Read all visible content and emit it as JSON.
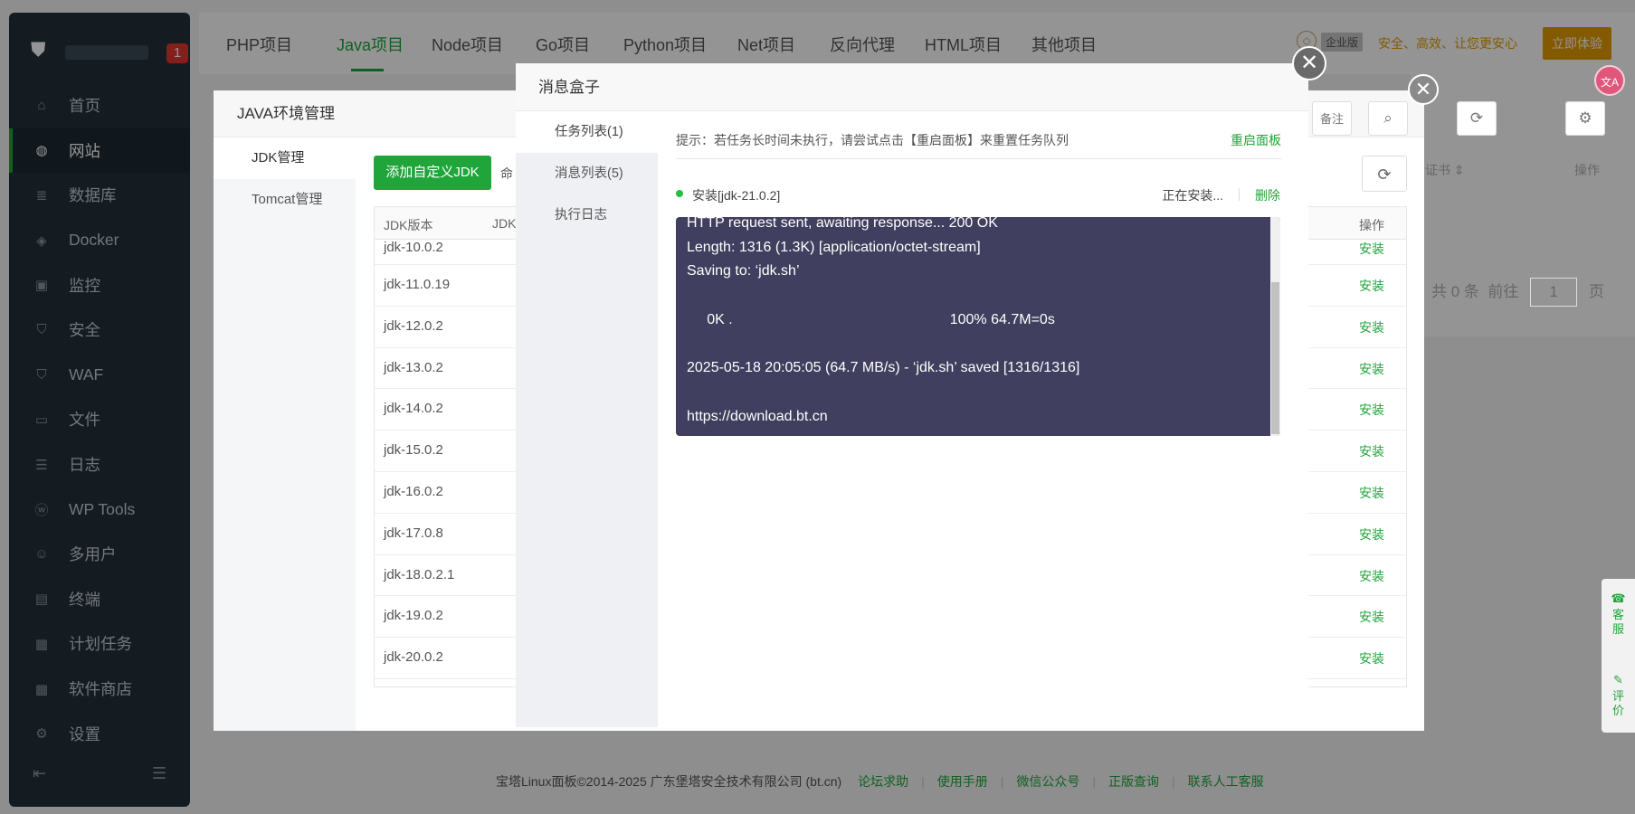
{
  "sidebar": {
    "notify_count": "1",
    "items": [
      {
        "label": "首页",
        "icon": "home-icon",
        "glyph": "⌂"
      },
      {
        "label": "网站",
        "icon": "globe-icon",
        "glyph": "◍"
      },
      {
        "label": "数据库",
        "icon": "database-icon",
        "glyph": "≣"
      },
      {
        "label": "Docker",
        "icon": "docker-icon",
        "glyph": "◈"
      },
      {
        "label": "监控",
        "icon": "monitor-icon",
        "glyph": "▣"
      },
      {
        "label": "安全",
        "icon": "shield-icon",
        "glyph": "⛉"
      },
      {
        "label": "WAF",
        "icon": "waf-shield-icon",
        "glyph": "⛉"
      },
      {
        "label": "文件",
        "icon": "folder-icon",
        "glyph": "▭"
      },
      {
        "label": "日志",
        "icon": "log-icon",
        "glyph": "☰"
      },
      {
        "label": "WP Tools",
        "icon": "wordpress-icon",
        "glyph": "ⓦ"
      },
      {
        "label": "多用户",
        "icon": "users-icon",
        "glyph": "☺"
      },
      {
        "label": "终端",
        "icon": "terminal-icon",
        "glyph": "▤"
      },
      {
        "label": "计划任务",
        "icon": "calendar-icon",
        "glyph": "▦"
      },
      {
        "label": "软件商店",
        "icon": "apps-icon",
        "glyph": "▩"
      },
      {
        "label": "设置",
        "icon": "gear-icon",
        "glyph": "⚙"
      }
    ],
    "active_index": 1
  },
  "topbar": {
    "tabs": [
      "PHP项目",
      "Java项目",
      "Node项目",
      "Go项目",
      "Python项目",
      "Net项目",
      "反向代理",
      "HTML项目",
      "其他项目"
    ],
    "active_index": 1,
    "ent_badge": "企业版",
    "slogan": "安全、高效、让您更安心",
    "try_button": "立即体验"
  },
  "background": {
    "cert_header": "证书",
    "ops_header": "操作",
    "remark_cut": "备注",
    "pagination": {
      "total": "共 0 条",
      "goto": "前往",
      "page": "1",
      "unit": "页"
    }
  },
  "footer": {
    "copyright": "宝塔Linux面板©2014-2025 广东堡塔安全技术有限公司 (bt.cn)",
    "links": [
      "论坛求助",
      "使用手册",
      "微信公众号",
      "正版查询",
      "联系人工客服"
    ]
  },
  "java_dialog": {
    "title": "JAVA环境管理",
    "tabs": [
      "JDK管理",
      "Tomcat管理"
    ],
    "add_button": "添加自定义JDK",
    "cmd_cut": "命",
    "table": {
      "col_version": "JDK版本",
      "col_path_cut": "JDK",
      "col_action": "操作",
      "rows": [
        {
          "version": "jdk-10.0.2",
          "action": "安装"
        },
        {
          "version": "jdk-11.0.19",
          "action": "安装"
        },
        {
          "version": "jdk-12.0.2",
          "action": "安装"
        },
        {
          "version": "jdk-13.0.2",
          "action": "安装"
        },
        {
          "version": "jdk-14.0.2",
          "action": "安装"
        },
        {
          "version": "jdk-15.0.2",
          "action": "安装"
        },
        {
          "version": "jdk-16.0.2",
          "action": "安装"
        },
        {
          "version": "jdk-17.0.8",
          "action": "安装"
        },
        {
          "version": "jdk-18.0.2.1",
          "action": "安装"
        },
        {
          "version": "jdk-19.0.2",
          "action": "安装"
        },
        {
          "version": "jdk-20.0.2",
          "action": "安装"
        }
      ]
    }
  },
  "message_box": {
    "title": "消息盒子",
    "tabs": [
      "任务列表(1)",
      "消息列表(5)",
      "执行日志"
    ],
    "active_index": 0,
    "hint": "提示：若任务长时间未执行，请尝试点击【重启面板】来重置任务队列",
    "restart_link": "重启面板",
    "task": {
      "name": "安装[jdk-21.0.2]",
      "status": "正在安装...",
      "delete": "删除"
    },
    "terminal_lines": [
      "HTTP request sent, awaiting response... 200 OK",
      "Length: 1316 (1.3K) [application/octet-stream]",
      "Saving to: ‘jdk.sh’",
      "",
      "     0K .                                                      100% 64.7M=0s",
      "",
      "2025-05-18 20:05:05 (64.7 MB/s) - ‘jdk.sh’ saved [1316/1316]",
      "",
      "https://download.bt.cn"
    ]
  },
  "widgets": {
    "translate": "文A",
    "service": "客服",
    "review": "评价"
  }
}
